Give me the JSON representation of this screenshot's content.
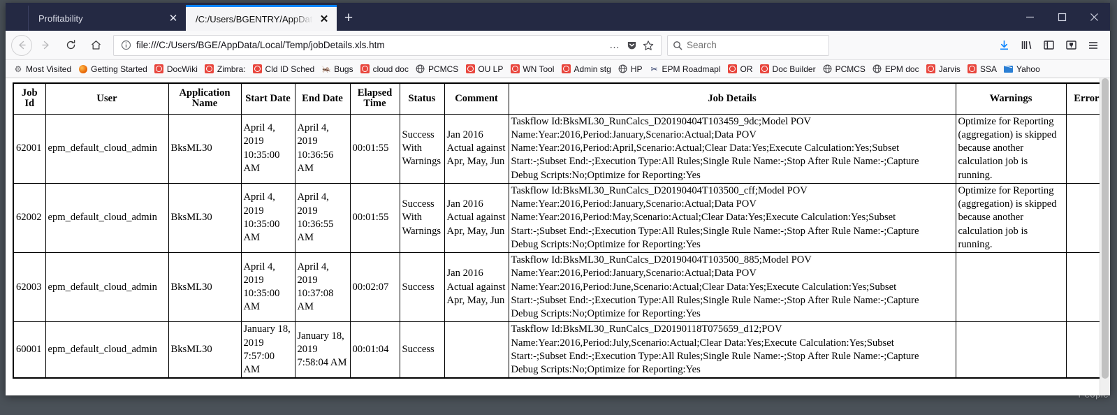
{
  "window": {
    "minimize_label": "—",
    "maximize_label": "□",
    "close_label": "✕"
  },
  "tabs": [
    {
      "label": "Profitability",
      "close": "✕",
      "active": false
    },
    {
      "label": "/C:/Users/BGENTRY/AppData/Loca",
      "close": "✕",
      "active": true
    }
  ],
  "new_tab_label": "+",
  "toolbar": {
    "back_icon": "back-arrow-icon",
    "forward_icon": "forward-arrow-icon",
    "reload_icon": "reload-icon",
    "home_icon": "home-icon",
    "url": "file:///C:/Users/BGE/AppData/Local/Temp/jobDetails.xls.htm",
    "identity_icon": "info-circle-icon",
    "page_actions_label": "…",
    "pocket_icon": "pocket-icon",
    "bookmark_star_label": "☆",
    "search_placeholder": "Search",
    "downloads_icon": "download-arrow-icon",
    "library_icon": "library-icon",
    "sidebar_icon": "sidebar-icon",
    "container_icon": "container-tabs-icon",
    "menu_icon": "hamburger-menu-icon",
    "accent_color": "#0a84ff"
  },
  "bookmarks": [
    {
      "label": "Most Visited",
      "icon": "gear-icon"
    },
    {
      "label": "Getting Started",
      "icon": "firefox-icon"
    },
    {
      "label": "DocWiki",
      "icon": "red-circle-icon"
    },
    {
      "label": "Zimbra:",
      "icon": "red-circle-icon"
    },
    {
      "label": "Cld ID Sched",
      "icon": "red-circle-icon"
    },
    {
      "label": "Bugs",
      "icon": "bug-icon"
    },
    {
      "label": "cloud doc",
      "icon": "red-circle-icon"
    },
    {
      "label": "PCMCS",
      "icon": "globe-icon"
    },
    {
      "label": "OU LP",
      "icon": "red-circle-icon"
    },
    {
      "label": "WN Tool",
      "icon": "red-circle-icon"
    },
    {
      "label": "Admin stg",
      "icon": "red-circle-icon"
    },
    {
      "label": "HP",
      "icon": "globe-icon"
    },
    {
      "label": "EPM Roadmapl",
      "icon": "scissors-icon"
    },
    {
      "label": "OR",
      "icon": "red-circle-icon"
    },
    {
      "label": "Doc Builder",
      "icon": "red-circle-icon"
    },
    {
      "label": "PCMCS",
      "icon": "globe-icon"
    },
    {
      "label": "EPM doc",
      "icon": "globe-icon"
    },
    {
      "label": "Jarvis",
      "icon": "red-circle-icon"
    },
    {
      "label": "SSA",
      "icon": "red-circle-icon"
    },
    {
      "label": "Yahoo",
      "icon": "mail-icon"
    }
  ],
  "table": {
    "headers": [
      "Job Id",
      "User",
      "Application Name",
      "Start Date",
      "End Date",
      "Elapsed Time",
      "Status",
      "Comment",
      "Job Details",
      "Warnings",
      "Errors"
    ],
    "rows": [
      {
        "job_id": "62001",
        "user": "epm_default_cloud_admin",
        "application_name": "BksML30",
        "start_date": "April 4, 2019 10:35:00 AM",
        "end_date": "April 4, 2019 10:36:56 AM",
        "elapsed_time": "00:01:55",
        "status": "Success With Warnings",
        "comment": "Jan 2016 Actual against Apr, May, Jun",
        "job_details": "Taskflow Id:BksML30_RunCalcs_D20190404T103459_9dc;Model POV\nName:Year:2016,Period:January,Scenario:Actual;Data POV\nName:Year:2016,Period:April,Scenario:Actual;Clear Data:Yes;Execute Calculation:Yes;Subset\nStart:-;Subset End:-;Execution Type:All Rules;Single Rule Name:-;Stop After Rule Name:-;Capture\nDebug Scripts:No;Optimize for Reporting:Yes",
        "warnings": "Optimize for Reporting (aggregation) is skipped because another calculation job is running.",
        "errors": ""
      },
      {
        "job_id": "62002",
        "user": "epm_default_cloud_admin",
        "application_name": "BksML30",
        "start_date": "April 4, 2019 10:35:00 AM",
        "end_date": "April 4, 2019 10:36:55 AM",
        "elapsed_time": "00:01:55",
        "status": "Success With Warnings",
        "comment": "Jan 2016 Actual against Apr, May, Jun",
        "job_details": "Taskflow Id:BksML30_RunCalcs_D20190404T103500_cff;Model POV\nName:Year:2016,Period:January,Scenario:Actual;Data POV\nName:Year:2016,Period:May,Scenario:Actual;Clear Data:Yes;Execute Calculation:Yes;Subset\nStart:-;Subset End:-;Execution Type:All Rules;Single Rule Name:-;Stop After Rule Name:-;Capture\nDebug Scripts:No;Optimize for Reporting:Yes",
        "warnings": "Optimize for Reporting (aggregation) is skipped because another calculation job is running.",
        "errors": ""
      },
      {
        "job_id": "62003",
        "user": "epm_default_cloud_admin",
        "application_name": "BksML30",
        "start_date": "April 4, 2019 10:35:00 AM",
        "end_date": "April 4, 2019 10:37:08 AM",
        "elapsed_time": "00:02:07",
        "status": "Success",
        "comment": "Jan 2016 Actual against Apr, May, Jun",
        "job_details": "Taskflow Id:BksML30_RunCalcs_D20190404T103500_885;Model POV\nName:Year:2016,Period:January,Scenario:Actual;Data POV\nName:Year:2016,Period:June,Scenario:Actual;Clear Data:Yes;Execute Calculation:Yes;Subset\nStart:-;Subset End:-;Execution Type:All Rules;Single Rule Name:-;Stop After Rule Name:-;Capture\nDebug Scripts:No;Optimize for Reporting:Yes",
        "warnings": "",
        "errors": ""
      },
      {
        "job_id": "60001",
        "user": "epm_default_cloud_admin",
        "application_name": "BksML30",
        "start_date": "January 18, 2019 7:57:00 AM",
        "end_date": "January 18, 2019 7:58:04 AM",
        "elapsed_time": "00:01:04",
        "status": "Success",
        "comment": "",
        "job_details": "Taskflow Id:BksML30_RunCalcs_D20190118T075659_d12;POV\nName:Year:2016,Period:July,Scenario:Actual;Clear Data:Yes;Execute Calculation:Yes;Subset\nStart:-;Subset End:-;Execution Type:All Rules;Single Rule Name:-;Stop After Rule Name:-;Capture\nDebug Scripts:No;Optimize for Reporting:Yes",
        "warnings": "",
        "errors": ""
      }
    ]
  },
  "desktop": {
    "people_label": "People"
  }
}
